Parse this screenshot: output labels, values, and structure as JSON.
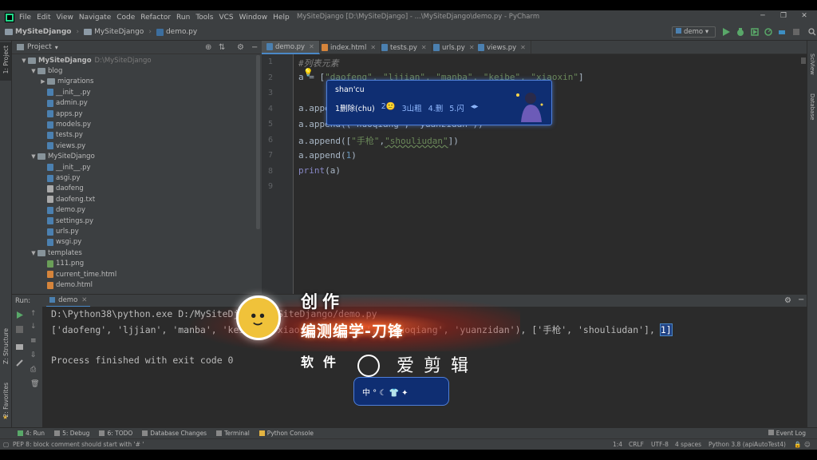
{
  "titlebar": {
    "menu": [
      "File",
      "Edit",
      "View",
      "Navigate",
      "Code",
      "Refactor",
      "Run",
      "Tools",
      "VCS",
      "Window",
      "Help"
    ],
    "window_title": "MySiteDjango [D:\\MySiteDjango] - ...\\MySiteDjango\\demo.py - PyCharm"
  },
  "navbar": {
    "crumbs": [
      "MySiteDjango",
      "MySiteDjango",
      "demo.py"
    ],
    "run_config": "demo"
  },
  "left_stripe": {
    "project": "1: Project",
    "structure": "Z: Structure",
    "favorites": "2: Favorites"
  },
  "right_stripe": {
    "sciview": "SciView",
    "database": "Database"
  },
  "project_panel": {
    "title": "Project",
    "root": {
      "name": "MySiteDjango",
      "path": "D:\\MySiteDjango"
    },
    "tree": [
      {
        "name": "blog",
        "kind": "folder",
        "depth": 1,
        "open": true
      },
      {
        "name": "migrations",
        "kind": "folder",
        "depth": 2,
        "open": false
      },
      {
        "name": "__init__.py",
        "kind": "py",
        "depth": 2
      },
      {
        "name": "admin.py",
        "kind": "py",
        "depth": 2
      },
      {
        "name": "apps.py",
        "kind": "py",
        "depth": 2
      },
      {
        "name": "models.py",
        "kind": "py",
        "depth": 2
      },
      {
        "name": "tests.py",
        "kind": "py",
        "depth": 2
      },
      {
        "name": "views.py",
        "kind": "py",
        "depth": 2
      },
      {
        "name": "MySiteDjango",
        "kind": "folder",
        "depth": 1,
        "open": true
      },
      {
        "name": "__init__.py",
        "kind": "py",
        "depth": 2
      },
      {
        "name": "asgi.py",
        "kind": "py",
        "depth": 2
      },
      {
        "name": "daofeng",
        "kind": "txt",
        "depth": 2
      },
      {
        "name": "daofeng.txt",
        "kind": "txt",
        "depth": 2
      },
      {
        "name": "demo.py",
        "kind": "py",
        "depth": 2
      },
      {
        "name": "settings.py",
        "kind": "py",
        "depth": 2
      },
      {
        "name": "urls.py",
        "kind": "py",
        "depth": 2
      },
      {
        "name": "wsgi.py",
        "kind": "py",
        "depth": 2
      },
      {
        "name": "templates",
        "kind": "folder",
        "depth": 1,
        "open": true
      },
      {
        "name": "111.png",
        "kind": "png",
        "depth": 2
      },
      {
        "name": "current_time.html",
        "kind": "html",
        "depth": 2
      },
      {
        "name": "demo.html",
        "kind": "html",
        "depth": 2
      }
    ]
  },
  "editor_tabs": [
    "demo.py",
    "index.html",
    "tests.py",
    "urls.py",
    "views.py"
  ],
  "active_tab": "demo.py",
  "editor": {
    "line_numbers": [
      "1",
      "2",
      "3",
      "4",
      "5",
      "6",
      "7",
      "8",
      "9"
    ],
    "line1": "#列表元素",
    "line2_pre": "a = [",
    "line2_str": "\"daofeng\", \"ljjian\", \"manba\", \"keibe\", \"xiaoxin\"",
    "line2_post": "]",
    "line4": "a.append(\"lishi\")",
    "line5": "a.append((\"huoqiang\", \"yuanzidan\"))",
    "line6_pre": "a.append([",
    "line6_str1": "\"手枪\"",
    "line6_comma": ",",
    "line6_str2": "\"shouliudan\"",
    "line6_post": "])",
    "line7_pre": "a.append(",
    "line7_num": "1",
    "line7_post": ")",
    "line8_fn": "print",
    "line8_rest": "(a)"
  },
  "ime": {
    "input": "shan'cu",
    "candidates": [
      "1删除(chu)",
      "2🙂",
      "3山粗",
      "4.删",
      "5.闪"
    ]
  },
  "run_panel": {
    "label": "Run:",
    "tab": "demo",
    "command": "D:\\Python38\\python.exe D:/MySiteDjango/MySiteDjango/demo.py",
    "output_pre": "['daofeng', 'ljjian', 'manba', 'keibe', 'xiaoxin', 'lishi', ('huoqiang', 'yuanzidan'), ['手枪', 'shouliudan'], ",
    "output_sel": "1]",
    "exit": "Process finished with exit code 0"
  },
  "overlay": {
    "title": "创作",
    "subtitle": "编测编学-刀锋",
    "software": "软件",
    "app": "爱剪辑",
    "ime_mini": "中 ° ☾ 👕 ✦"
  },
  "bottom_tabs": [
    "4: Run",
    "5: Debug",
    "6: TODO",
    "Database Changes",
    "Terminal",
    "Python Console"
  ],
  "event_log": "Event Log",
  "status": {
    "message": "PEP 8: block comment should start with '# '",
    "position": "1:4",
    "line_sep": "CRLF",
    "encoding": "UTF-8",
    "indent": "4 spaces",
    "interpreter": "Python 3.8 (apiAutoTest4)"
  }
}
